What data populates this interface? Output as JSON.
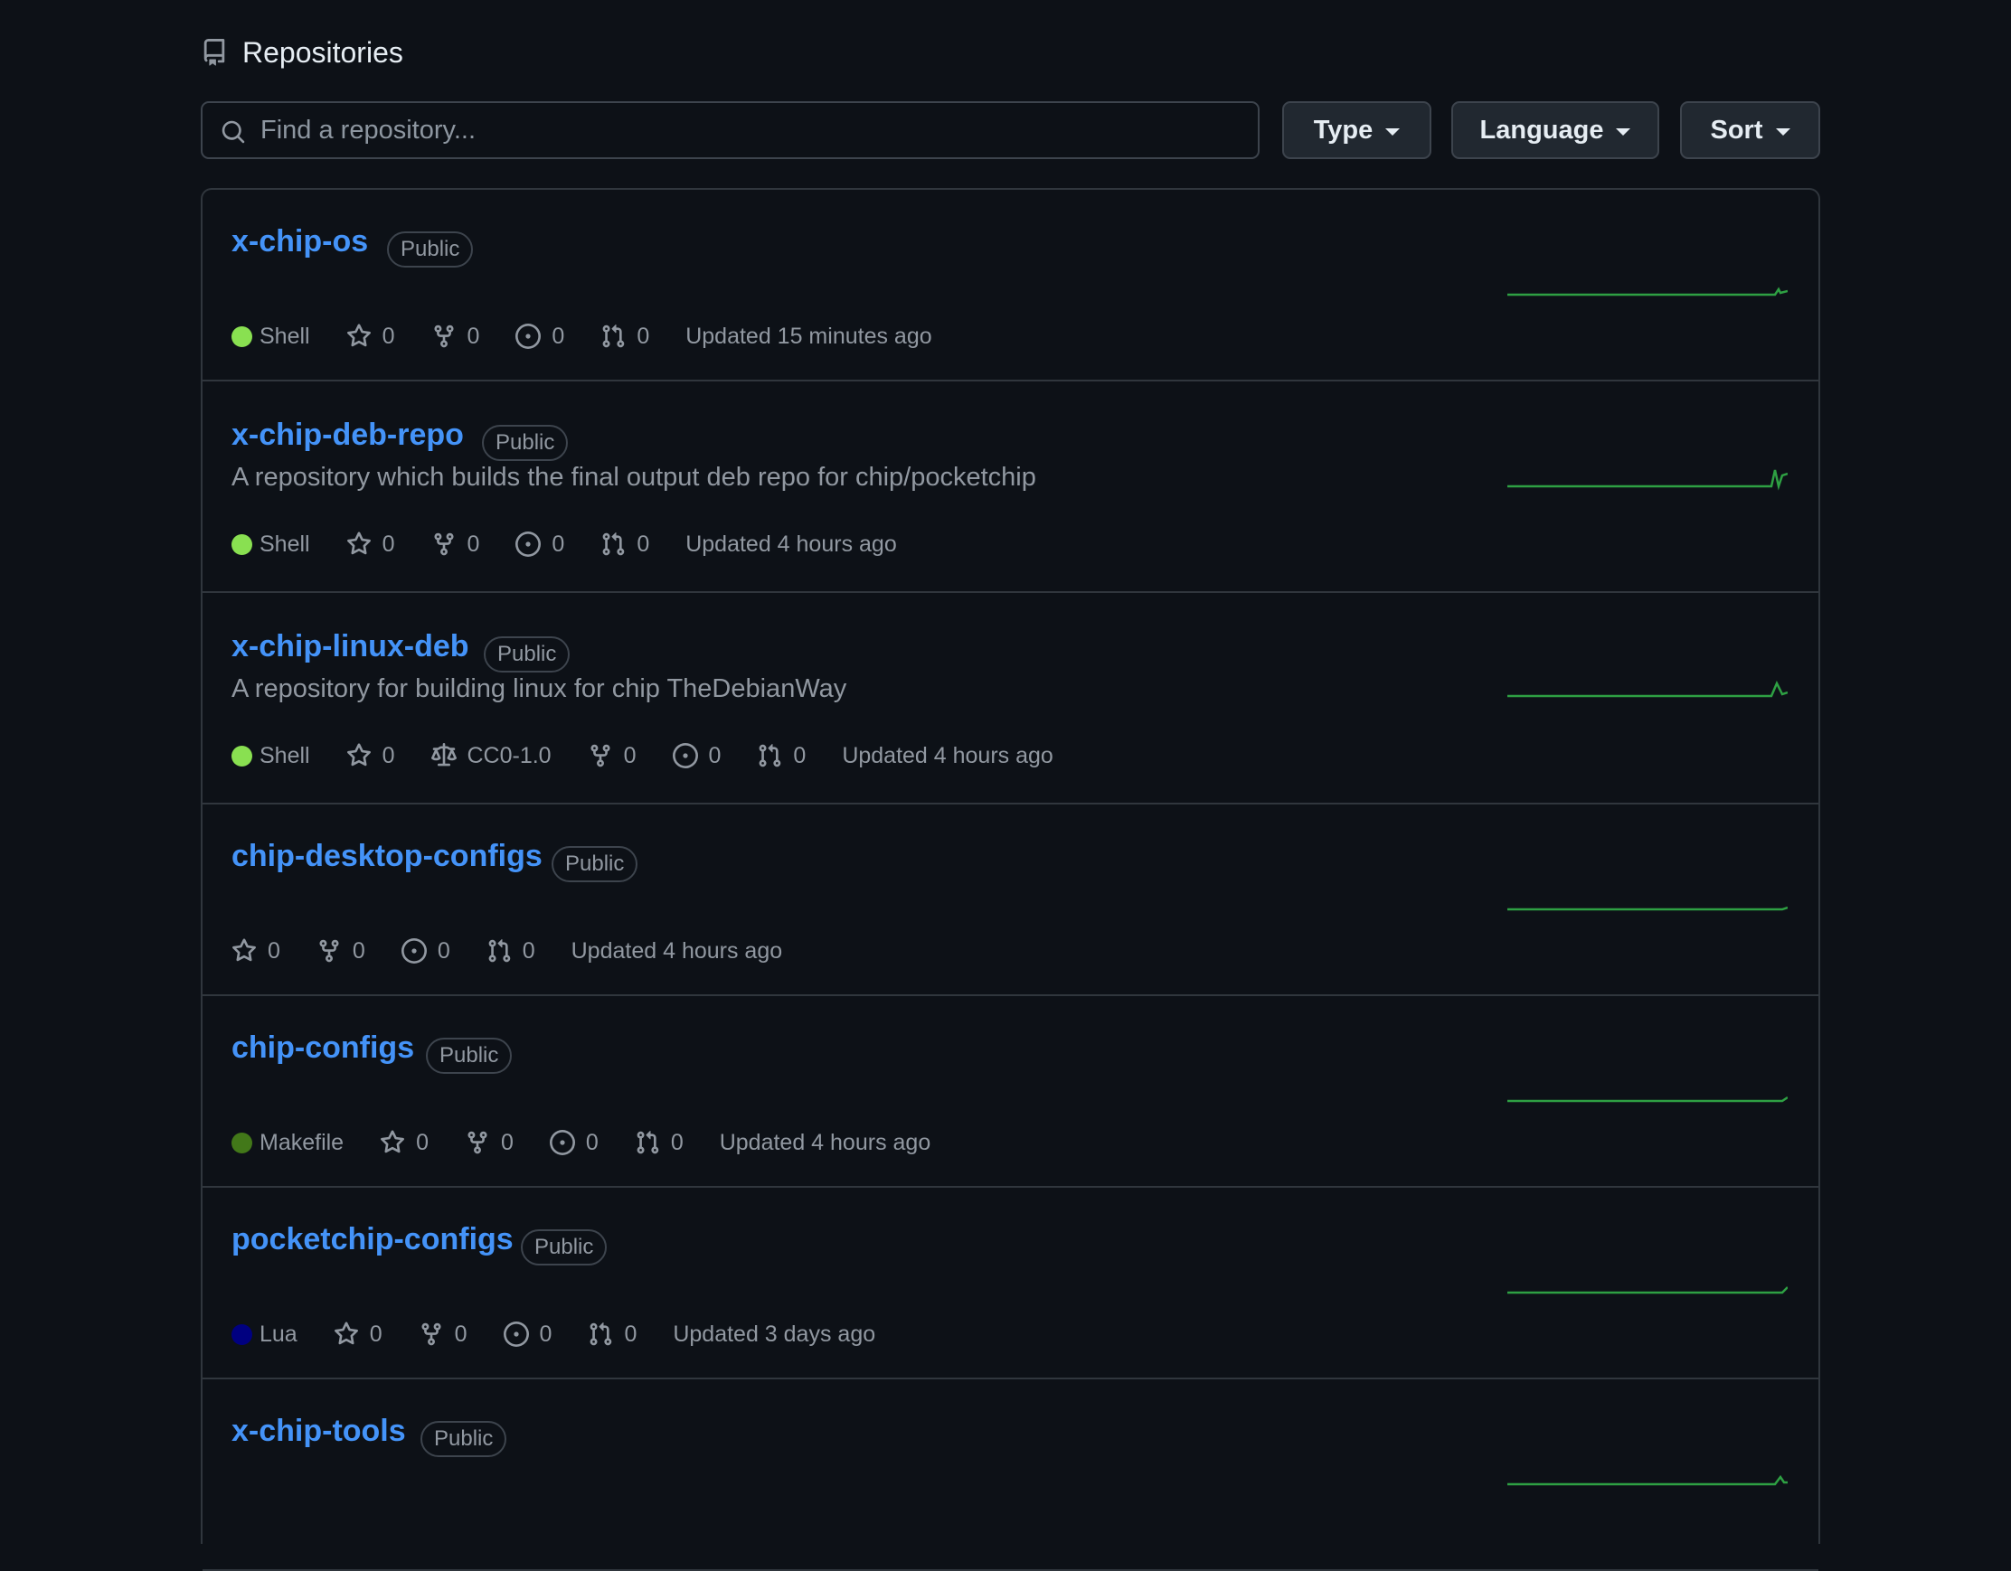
{
  "header": {
    "title": "Repositories"
  },
  "search": {
    "placeholder": "Find a repository..."
  },
  "filters": {
    "type_label": "Type",
    "language_label": "Language",
    "sort_label": "Sort"
  },
  "repos": [
    {
      "name": "x-chip-os",
      "visibility": "Public",
      "description": "",
      "language": "Shell",
      "language_color": "#89e051",
      "stars": "0",
      "forks": "0",
      "issues": "0",
      "pulls": "0",
      "license": "",
      "updated": "Updated 15 minutes ago"
    },
    {
      "name": "x-chip-deb-repo",
      "visibility": "Public",
      "description": "A repository which builds the final output deb repo for chip/pocketchip",
      "language": "Shell",
      "language_color": "#89e051",
      "stars": "0",
      "forks": "0",
      "issues": "0",
      "pulls": "0",
      "license": "",
      "updated": "Updated 4 hours ago"
    },
    {
      "name": "x-chip-linux-deb",
      "visibility": "Public",
      "description": "A repository for building linux for chip TheDebianWay",
      "language": "Shell",
      "language_color": "#89e051",
      "stars": "0",
      "forks": "0",
      "issues": "0",
      "pulls": "0",
      "license": "CC0-1.0",
      "updated": "Updated 4 hours ago"
    },
    {
      "name": "chip-desktop-configs",
      "visibility": "Public",
      "description": "",
      "language": "",
      "language_color": "",
      "stars": "0",
      "forks": "0",
      "issues": "0",
      "pulls": "0",
      "license": "",
      "updated": "Updated 4 hours ago"
    },
    {
      "name": "chip-configs",
      "visibility": "Public",
      "description": "",
      "language": "Makefile",
      "language_color": "#427819",
      "stars": "0",
      "forks": "0",
      "issues": "0",
      "pulls": "0",
      "license": "",
      "updated": "Updated 4 hours ago"
    },
    {
      "name": "pocketchip-configs",
      "visibility": "Public",
      "description": "",
      "language": "Lua",
      "language_color": "#000080",
      "stars": "0",
      "forks": "0",
      "issues": "0",
      "pulls": "0",
      "license": "",
      "updated": "Updated 3 days ago"
    },
    {
      "name": "x-chip-tools",
      "visibility": "Public",
      "description": "",
      "language": "",
      "language_color": "",
      "stars": "",
      "forks": "",
      "issues": "",
      "pulls": "",
      "license": "",
      "updated": ""
    }
  ],
  "colors": {
    "link": "#4493f8",
    "spark": "#2ea043",
    "muted": "#9198a1",
    "border": "#30363d"
  },
  "icons": {
    "header": "repo-icon",
    "search": "search-icon",
    "star": "star-icon",
    "fork": "fork-icon",
    "issue": "issue-icon",
    "pull": "pull-request-icon",
    "license": "law-icon"
  }
}
